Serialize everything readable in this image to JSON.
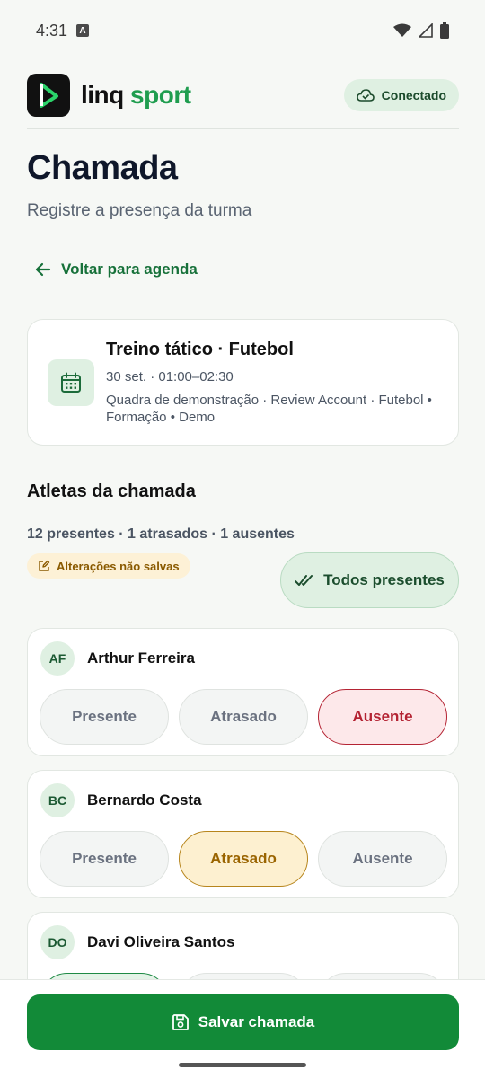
{
  "status_bar": {
    "time": "4:31"
  },
  "header": {
    "brand_linq": "linq",
    "brand_sport": "sport",
    "connection_status": "Conectado"
  },
  "page": {
    "title": "Chamada",
    "subtitle": "Registre a presença da turma",
    "back_label": "Voltar para agenda"
  },
  "event": {
    "title": "Treino tático · Futebol",
    "time": "30 set. · 01:00–02:30",
    "details": "Quadra de demonstração · Review Account · Futebol • Formação • Demo"
  },
  "section": {
    "title": "Atletas da chamada",
    "summary": "12 presentes · 1 atrasados · 1 ausentes",
    "unsaved_label": "Alterações não salvas",
    "all_present_label": "Todos presentes"
  },
  "options": {
    "present": "Presente",
    "late": "Atrasado",
    "absent": "Ausente"
  },
  "athletes": [
    {
      "initials": "AF",
      "name": "Arthur Ferreira",
      "status": "absent"
    },
    {
      "initials": "BC",
      "name": "Bernardo Costa",
      "status": "late"
    },
    {
      "initials": "DO",
      "name": "Davi Oliveira Santos",
      "status": "present"
    }
  ],
  "footer": {
    "save_label": "Salvar chamada"
  },
  "colors": {
    "brand_green": "#128a38",
    "accent_sport": "#1f9d4f",
    "absent": "#b42333",
    "late": "#b7851c"
  }
}
